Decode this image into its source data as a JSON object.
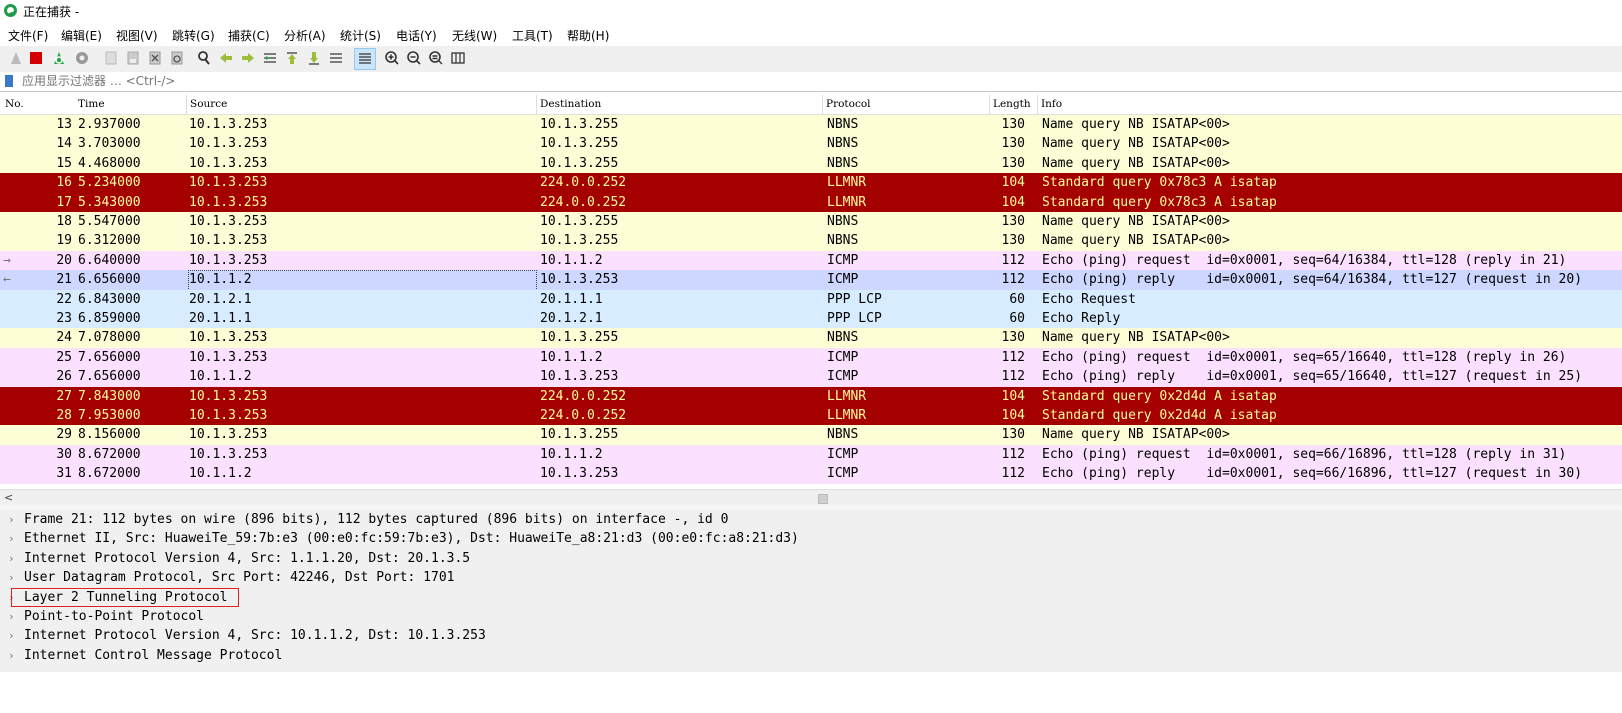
{
  "window": {
    "title": "正在捕获 -"
  },
  "menu": [
    "文件(F)",
    "编辑(E)",
    "视图(V)",
    "跳转(G)",
    "捕获(C)",
    "分析(A)",
    "统计(S)",
    "电话(Y)",
    "无线(W)",
    "工具(T)",
    "帮助(H)"
  ],
  "filter": {
    "placeholder": "应用显示过滤器 … <Ctrl-/>"
  },
  "columns": [
    "No.",
    "Time",
    "Source",
    "Destination",
    "Protocol",
    "Length",
    "Info"
  ],
  "colors": {
    "nbns": "#fefed6",
    "llmnr": "#a40000",
    "icmp": "#fce0ff",
    "ppp": "#d8ecff",
    "selected": "#cdd7ff"
  },
  "packets": [
    {
      "no": "13",
      "time": "2.937000",
      "src": "10.1.3.253",
      "dst": "10.1.3.255",
      "proto": "NBNS",
      "len": "130",
      "info": "Name query NB ISATAP<00>",
      "kind": "nbns",
      "mark": ""
    },
    {
      "no": "14",
      "time": "3.703000",
      "src": "10.1.3.253",
      "dst": "10.1.3.255",
      "proto": "NBNS",
      "len": "130",
      "info": "Name query NB ISATAP<00>",
      "kind": "nbns",
      "mark": ""
    },
    {
      "no": "15",
      "time": "4.468000",
      "src": "10.1.3.253",
      "dst": "10.1.3.255",
      "proto": "NBNS",
      "len": "130",
      "info": "Name query NB ISATAP<00>",
      "kind": "nbns",
      "mark": ""
    },
    {
      "no": "16",
      "time": "5.234000",
      "src": "10.1.3.253",
      "dst": "224.0.0.252",
      "proto": "LLMNR",
      "len": "104",
      "info": "Standard query 0x78c3 A isatap",
      "kind": "llmnr",
      "mark": ""
    },
    {
      "no": "17",
      "time": "5.343000",
      "src": "10.1.3.253",
      "dst": "224.0.0.252",
      "proto": "LLMNR",
      "len": "104",
      "info": "Standard query 0x78c3 A isatap",
      "kind": "llmnr",
      "mark": ""
    },
    {
      "no": "18",
      "time": "5.547000",
      "src": "10.1.3.253",
      "dst": "10.1.3.255",
      "proto": "NBNS",
      "len": "130",
      "info": "Name query NB ISATAP<00>",
      "kind": "nbns",
      "mark": ""
    },
    {
      "no": "19",
      "time": "6.312000",
      "src": "10.1.3.253",
      "dst": "10.1.3.255",
      "proto": "NBNS",
      "len": "130",
      "info": "Name query NB ISATAP<00>",
      "kind": "nbns",
      "mark": ""
    },
    {
      "no": "20",
      "time": "6.640000",
      "src": "10.1.3.253",
      "dst": "10.1.1.2",
      "proto": "ICMP",
      "len": "112",
      "info": "Echo (ping) request  id=0x0001, seq=64/16384, ttl=128 (reply in 21)",
      "kind": "icmp",
      "mark": "→"
    },
    {
      "no": "21",
      "time": "6.656000",
      "src": "10.1.1.2",
      "dst": "10.1.3.253",
      "proto": "ICMP",
      "len": "112",
      "info": "Echo (ping) reply    id=0x0001, seq=64/16384, ttl=127 (request in 20)",
      "kind": "selected",
      "mark": "←"
    },
    {
      "no": "22",
      "time": "6.843000",
      "src": "20.1.2.1",
      "dst": "20.1.1.1",
      "proto": "PPP LCP",
      "len": "60",
      "info": "Echo Request",
      "kind": "ppp",
      "mark": ""
    },
    {
      "no": "23",
      "time": "6.859000",
      "src": "20.1.1.1",
      "dst": "20.1.2.1",
      "proto": "PPP LCP",
      "len": "60",
      "info": "Echo Reply",
      "kind": "ppp",
      "mark": ""
    },
    {
      "no": "24",
      "time": "7.078000",
      "src": "10.1.3.253",
      "dst": "10.1.3.255",
      "proto": "NBNS",
      "len": "130",
      "info": "Name query NB ISATAP<00>",
      "kind": "nbns",
      "mark": ""
    },
    {
      "no": "25",
      "time": "7.656000",
      "src": "10.1.3.253",
      "dst": "10.1.1.2",
      "proto": "ICMP",
      "len": "112",
      "info": "Echo (ping) request  id=0x0001, seq=65/16640, ttl=128 (reply in 26)",
      "kind": "icmp",
      "mark": ""
    },
    {
      "no": "26",
      "time": "7.656000",
      "src": "10.1.1.2",
      "dst": "10.1.3.253",
      "proto": "ICMP",
      "len": "112",
      "info": "Echo (ping) reply    id=0x0001, seq=65/16640, ttl=127 (request in 25)",
      "kind": "icmp",
      "mark": ""
    },
    {
      "no": "27",
      "time": "7.843000",
      "src": "10.1.3.253",
      "dst": "224.0.0.252",
      "proto": "LLMNR",
      "len": "104",
      "info": "Standard query 0x2d4d A isatap",
      "kind": "llmnr",
      "mark": ""
    },
    {
      "no": "28",
      "time": "7.953000",
      "src": "10.1.3.253",
      "dst": "224.0.0.252",
      "proto": "LLMNR",
      "len": "104",
      "info": "Standard query 0x2d4d A isatap",
      "kind": "llmnr",
      "mark": ""
    },
    {
      "no": "29",
      "time": "8.156000",
      "src": "10.1.3.253",
      "dst": "10.1.3.255",
      "proto": "NBNS",
      "len": "130",
      "info": "Name query NB ISATAP<00>",
      "kind": "nbns",
      "mark": ""
    },
    {
      "no": "30",
      "time": "8.672000",
      "src": "10.1.3.253",
      "dst": "10.1.1.2",
      "proto": "ICMP",
      "len": "112",
      "info": "Echo (ping) request  id=0x0001, seq=66/16896, ttl=128 (reply in 31)",
      "kind": "icmp",
      "mark": ""
    },
    {
      "no": "31",
      "time": "8.672000",
      "src": "10.1.1.2",
      "dst": "10.1.3.253",
      "proto": "ICMP",
      "len": "112",
      "info": "Echo (ping) reply    id=0x0001, seq=66/16896, ttl=127 (request in 30)",
      "kind": "icmp",
      "mark": ""
    }
  ],
  "details": [
    {
      "text": "Frame 21: 112 bytes on wire (896 bits), 112 bytes captured (896 bits) on interface -, id 0",
      "highlight": false
    },
    {
      "text": "Ethernet II, Src: HuaweiTe_59:7b:e3 (00:e0:fc:59:7b:e3), Dst: HuaweiTe_a8:21:d3 (00:e0:fc:a8:21:d3)",
      "highlight": false
    },
    {
      "text": "Internet Protocol Version 4, Src: 1.1.1.20, Dst: 20.1.3.5",
      "highlight": false
    },
    {
      "text": "User Datagram Protocol, Src Port: 42246, Dst Port: 1701",
      "highlight": false
    },
    {
      "text": "Layer 2 Tunneling Protocol",
      "highlight": true
    },
    {
      "text": "Point-to-Point Protocol",
      "highlight": false
    },
    {
      "text": "Internet Protocol Version 4, Src: 10.1.1.2, Dst: 10.1.3.253",
      "highlight": false
    },
    {
      "text": "Internet Control Message Protocol",
      "highlight": false
    }
  ]
}
